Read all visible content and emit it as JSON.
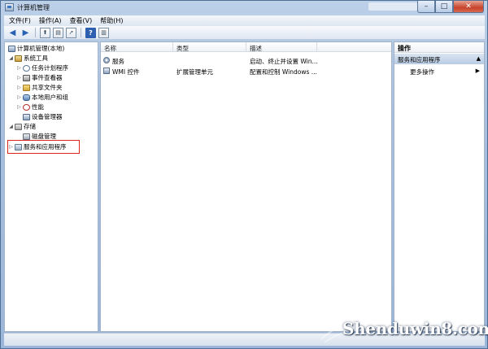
{
  "window": {
    "title": "计算机管理"
  },
  "menu": [
    "文件(F)",
    "操作(A)",
    "查看(V)",
    "帮助(H)"
  ],
  "tree": {
    "root": "计算机管理(本地)",
    "system_tools": "系统工具",
    "task_scheduler": "任务计划程序",
    "event_viewer": "事件查看器",
    "shared_folders": "共享文件夹",
    "local_users": "本地用户和组",
    "performance": "性能",
    "device_manager": "设备管理器",
    "storage": "存储",
    "disk_management": "磁盘管理",
    "services_apps": "服务和应用程序"
  },
  "list": {
    "columns": {
      "name": "名称",
      "type": "类型",
      "description": "描述"
    },
    "rows": [
      {
        "name": "服务",
        "type": "",
        "description": "启动、终止并设置 Win..."
      },
      {
        "name": "WMI 控件",
        "type": "扩展管理单元",
        "description": "配置和控制 Windows ..."
      }
    ]
  },
  "actions": {
    "title": "操作",
    "section": "服务和应用程序",
    "more": "更多操作"
  },
  "watermark": "Shenduwin8.com",
  "colors": {
    "highlight_box": "#e0241b",
    "close_button": "#c7432b"
  }
}
